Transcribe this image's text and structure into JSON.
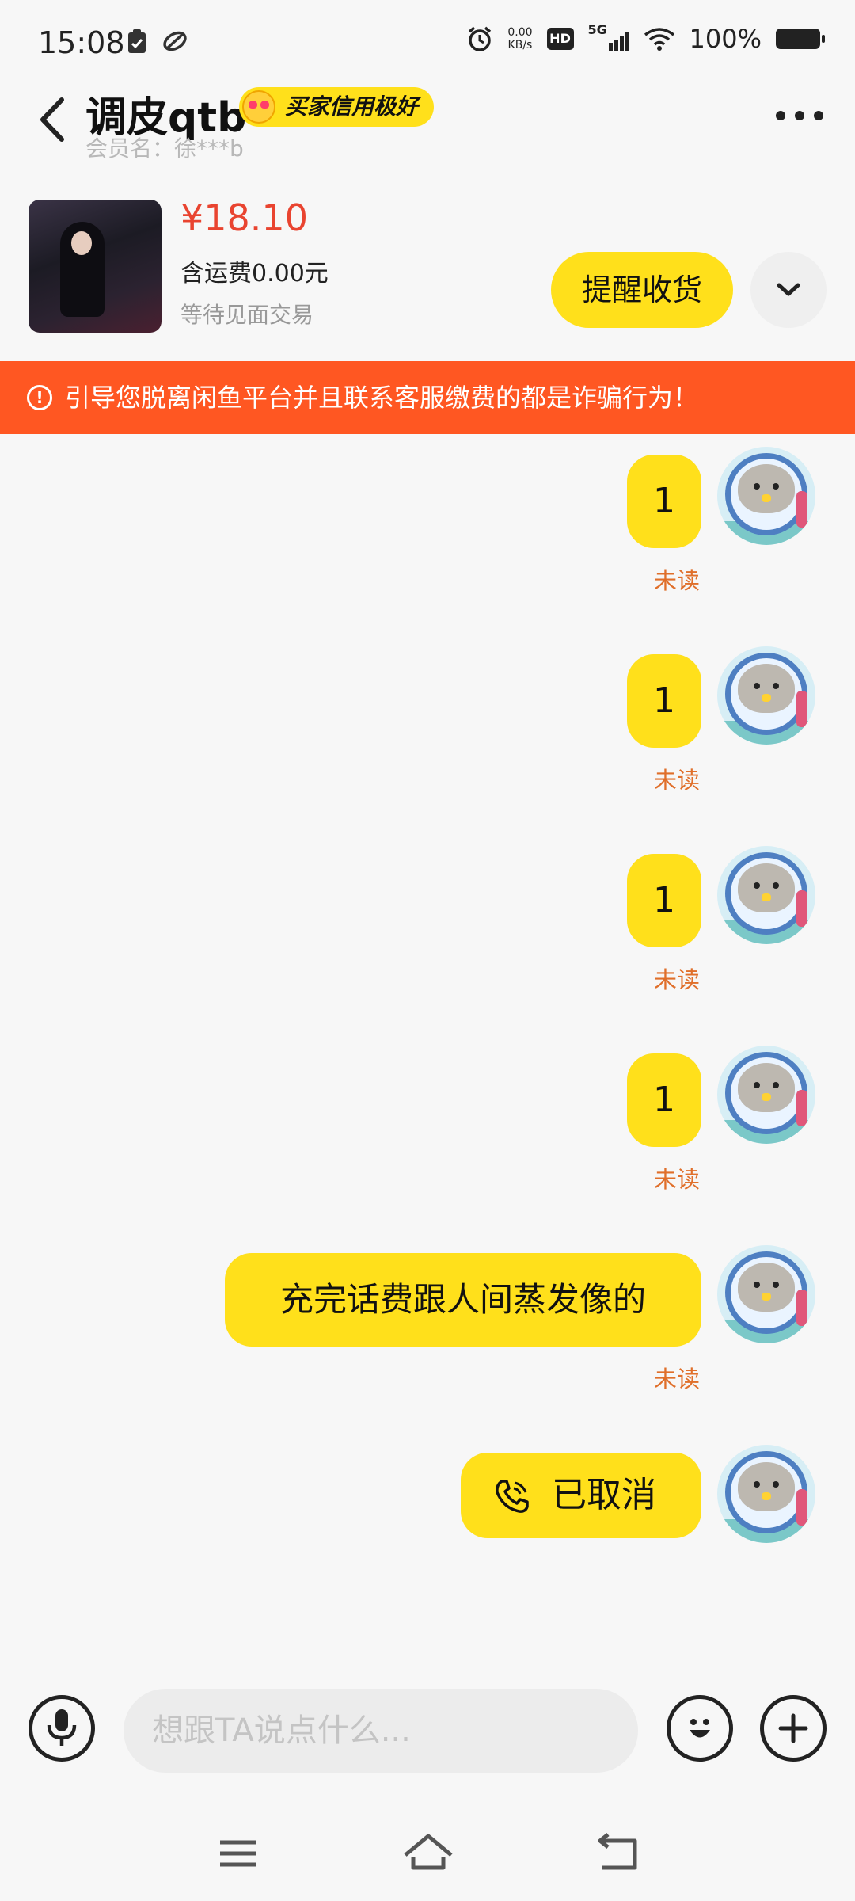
{
  "status_bar": {
    "time": "15:08",
    "net_speed_value": "0.00",
    "net_speed_unit": "KB/s",
    "hd_label": "HD",
    "network_label": "5G",
    "battery": "100%"
  },
  "header": {
    "title": "调皮qtb",
    "credit_badge": "买家信用极好",
    "member_label": "会员名：徐***b"
  },
  "product": {
    "price": "¥18.10",
    "shipping": "含运费0.00元",
    "status": "等待见面交易",
    "remind_button": "提醒收货"
  },
  "warning": {
    "text": "引导您脱离闲鱼平台并且联系客服缴费的都是诈骗行为！"
  },
  "messages": [
    {
      "text": "1",
      "status": "未读"
    },
    {
      "text": "1",
      "status": "未读"
    },
    {
      "text": "1",
      "status": "未读"
    },
    {
      "text": "1",
      "status": "未读"
    },
    {
      "text": "充完话费跟人间蒸发像的",
      "status": "未读"
    },
    {
      "text": "已取消",
      "type": "voice-call"
    }
  ],
  "input": {
    "placeholder": "想跟TA说点什么..."
  },
  "colors": {
    "accent_yellow": "#ffe01b",
    "warning_orange": "#ff5722",
    "price_red": "#e94430",
    "unread_orange": "#e06f2a"
  },
  "icons": [
    "back-arrow-icon",
    "more-icon",
    "chevron-down-icon",
    "warning-icon",
    "phone-icon",
    "mic-icon",
    "emoji-icon",
    "plus-icon",
    "menu-icon",
    "home-icon",
    "return-icon"
  ]
}
